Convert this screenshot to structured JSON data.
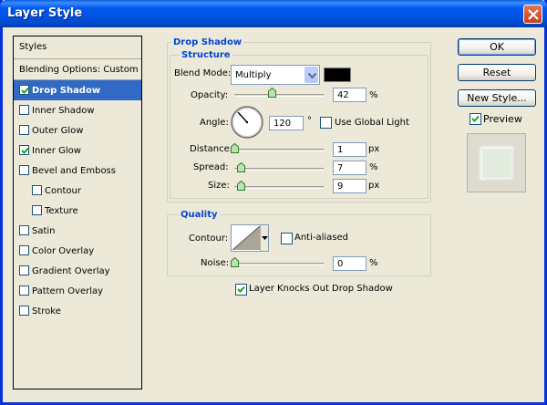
{
  "window": {
    "title": "Layer Style"
  },
  "styles": {
    "header": "Styles",
    "items": [
      {
        "label": "Blending Options: Custom",
        "checkbox": false,
        "checked": false,
        "selected": false,
        "indent": false
      },
      {
        "label": "Drop Shadow",
        "checkbox": true,
        "checked": true,
        "selected": true,
        "indent": false
      },
      {
        "label": "Inner Shadow",
        "checkbox": true,
        "checked": false,
        "selected": false,
        "indent": false
      },
      {
        "label": "Outer Glow",
        "checkbox": true,
        "checked": false,
        "selected": false,
        "indent": false
      },
      {
        "label": "Inner Glow",
        "checkbox": true,
        "checked": true,
        "selected": false,
        "indent": false
      },
      {
        "label": "Bevel and Emboss",
        "checkbox": true,
        "checked": false,
        "selected": false,
        "indent": false
      },
      {
        "label": "Contour",
        "checkbox": true,
        "checked": false,
        "selected": false,
        "indent": true
      },
      {
        "label": "Texture",
        "checkbox": true,
        "checked": false,
        "selected": false,
        "indent": true
      },
      {
        "label": "Satin",
        "checkbox": true,
        "checked": false,
        "selected": false,
        "indent": false
      },
      {
        "label": "Color Overlay",
        "checkbox": true,
        "checked": false,
        "selected": false,
        "indent": false
      },
      {
        "label": "Gradient Overlay",
        "checkbox": true,
        "checked": false,
        "selected": false,
        "indent": false
      },
      {
        "label": "Pattern Overlay",
        "checkbox": true,
        "checked": false,
        "selected": false,
        "indent": false
      },
      {
        "label": "Stroke",
        "checkbox": true,
        "checked": false,
        "selected": false,
        "indent": false
      }
    ]
  },
  "drop_shadow": {
    "title": "Drop Shadow",
    "structure": {
      "title": "Structure",
      "blend_mode_label": "Blend Mode:",
      "blend_mode_value": "Multiply",
      "shadow_color": "#000000",
      "opacity_label": "Opacity:",
      "opacity_value": "42",
      "opacity_unit": "%",
      "opacity_level": 0.42,
      "angle_label": "Angle:",
      "angle_value": "120",
      "angle_unit": "°",
      "use_global_light_label": "Use Global Light",
      "use_global_light_checked": false,
      "distance_label": "Distance:",
      "distance_value": "1",
      "distance_unit": "px",
      "distance_level": 0.0,
      "spread_label": "Spread:",
      "spread_value": "7",
      "spread_unit": "%",
      "spread_level": 0.07,
      "size_label": "Size:",
      "size_value": "9",
      "size_unit": "px",
      "size_level": 0.07
    },
    "quality": {
      "title": "Quality",
      "contour_label": "Contour:",
      "anti_aliased_label": "Anti-aliased",
      "anti_aliased_checked": false,
      "noise_label": "Noise:",
      "noise_value": "0",
      "noise_unit": "%",
      "noise_level": 0.0
    },
    "knockout_label": "Layer Knocks Out Drop Shadow",
    "knockout_checked": true
  },
  "buttons": {
    "ok": "OK",
    "reset": "Reset",
    "new_style": "New Style...",
    "preview_label": "Preview",
    "preview_checked": true
  },
  "colors": {
    "accent": "#316ac5",
    "group_title": "#0046d5",
    "slider_thumb": "#2f9d3a"
  }
}
